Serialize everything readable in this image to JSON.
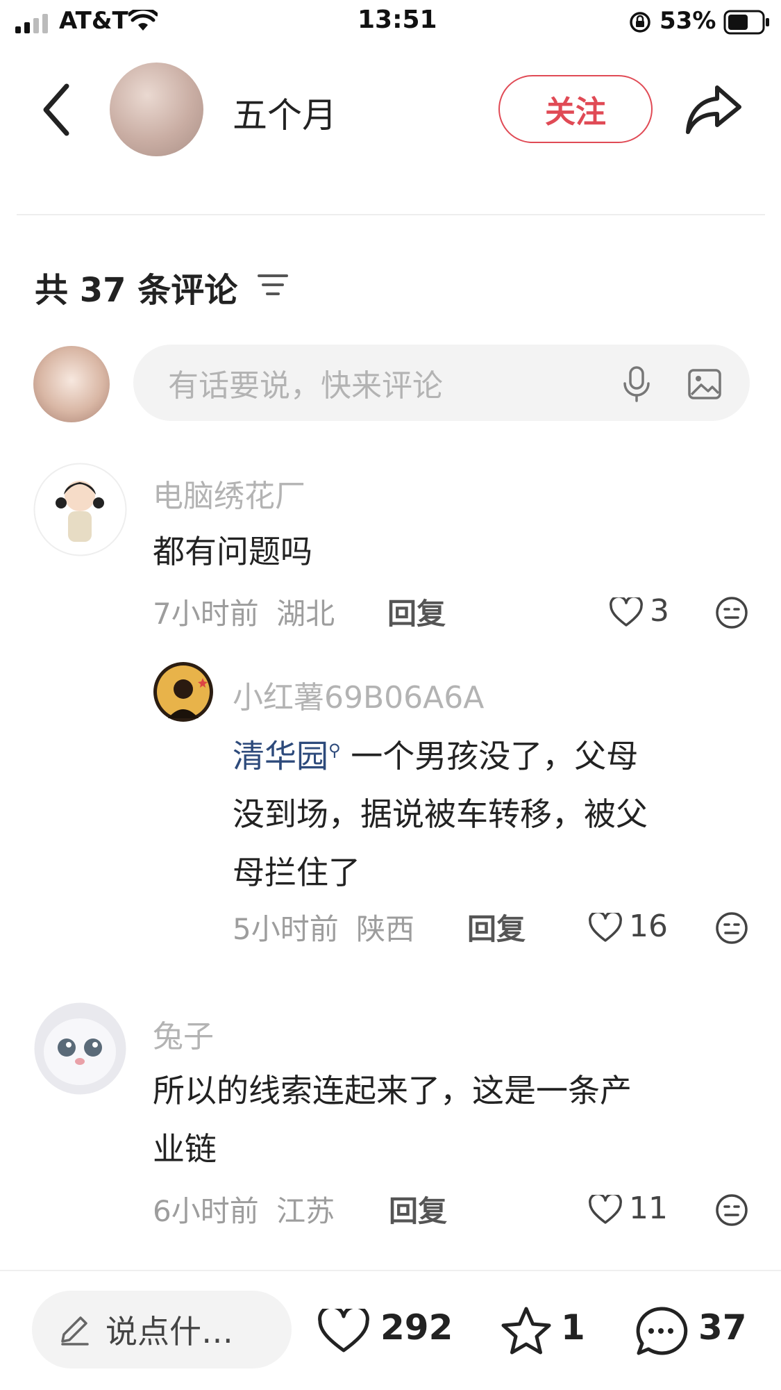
{
  "status_bar": {
    "carrier": "AT&T",
    "time": "13:51",
    "battery": "53%"
  },
  "header": {
    "author_name": "五个月",
    "follow_label": "关注"
  },
  "comments_section": {
    "title": "共 37 条评论",
    "input_placeholder": "有话要说，快来评论"
  },
  "comments": [
    {
      "user": "电脑绣花厂",
      "text": "都有问题吗",
      "time": "7小时前",
      "region": "湖北",
      "reply_label": "回复",
      "likes": "3"
    },
    {
      "user": "小红薯69B06A6A",
      "mention": "清华园",
      "text_line1": "一个男孩没了，父母",
      "text_line2": "没到场，据说被车转移，被父",
      "text_line3": "母拦住了",
      "time": "5小时前",
      "region": "陕西",
      "reply_label": "回复",
      "likes": "16"
    },
    {
      "user": "兔子",
      "text_line1": "所以的线索连起来了，这是一条产",
      "text_line2": "业链",
      "time": "6小时前",
      "region": "江苏",
      "reply_label": "回复",
      "likes": "11"
    }
  ],
  "bottom_bar": {
    "say_placeholder": "说点什…",
    "likes": "292",
    "favorites": "1",
    "comments": "37"
  },
  "colors": {
    "accent_red": "#e04a55",
    "mention_blue": "#2d4a7b",
    "input_bg": "#f3f3f3"
  },
  "icons": [
    "signal-icon",
    "wifi-icon",
    "lock-rotation-icon",
    "battery-icon",
    "back-arrow-icon",
    "share-icon",
    "filter-icon",
    "mic-icon",
    "image-icon",
    "heart-icon",
    "emoji-icon",
    "pencil-icon",
    "star-icon",
    "chat-bubble-icon"
  ]
}
